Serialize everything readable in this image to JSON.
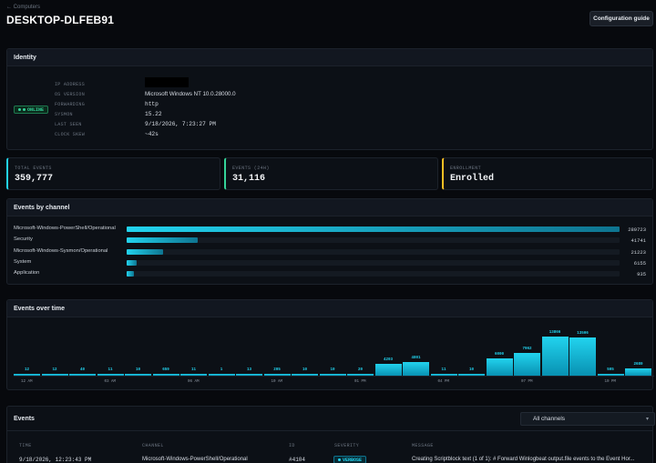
{
  "breadcrumb": "← Computers",
  "title": "DESKTOP-DLFEB91",
  "config_button": "Configuration guide",
  "identity": {
    "heading": "Identity",
    "status": "ONLINE",
    "rows": [
      {
        "label": "IP ADDRESS",
        "value": ""
      },
      {
        "label": "OS VERSION",
        "value": "Microsoft Windows NT 10.0.28000.0"
      },
      {
        "label": "FORWARDING",
        "value": "http"
      },
      {
        "label": "SYSMON",
        "value": "15.22"
      },
      {
        "label": "LAST SEEN",
        "value": "9/18/2026, 7:23:27 PM"
      },
      {
        "label": "CLOCK SKEW",
        "value": "~42s"
      }
    ]
  },
  "stats": [
    {
      "label": "TOTAL EVENTS",
      "value": "359,777",
      "accent": "#22d3ee"
    },
    {
      "label": "EVENTS (24H)",
      "value": "31,116",
      "accent": "#34d399"
    },
    {
      "label": "ENROLLMENT",
      "value": "Enrolled",
      "accent": "#fbbf24"
    }
  ],
  "channels": {
    "heading": "Events by channel",
    "max": 289723,
    "items": [
      {
        "name": "Microsoft-Windows-PowerShell/Operational",
        "count": 289723,
        "count_label": "289723"
      },
      {
        "name": "Security",
        "count": 41741,
        "count_label": "41741"
      },
      {
        "name": "Microsoft-Windows-Sysmon/Operational",
        "count": 21223,
        "count_label": "21223"
      },
      {
        "name": "System",
        "count": 6155,
        "count_label": "6155"
      },
      {
        "name": "Application",
        "count": 935,
        "count_label": "935"
      }
    ]
  },
  "timeline": {
    "heading": "Events over time",
    "max": 13506,
    "values": [
      12,
      12,
      40,
      11,
      10,
      659,
      11,
      1,
      13,
      205,
      10,
      10,
      20,
      4203,
      4801,
      11,
      10,
      6000,
      7962,
      13866,
      13506,
      505,
      2680
    ],
    "value_labels": [
      "12",
      "12",
      "40",
      "11",
      "10",
      "659",
      "11",
      "1",
      "13",
      "205",
      "10",
      "10",
      "20",
      "4203",
      "4801",
      "11",
      "10",
      "6000",
      "7962",
      "13866",
      "13506",
      "505",
      "2680"
    ],
    "ticks": [
      {
        "label": "12 AM",
        "index": 0
      },
      {
        "label": "03 AM",
        "index": 3
      },
      {
        "label": "06 AM",
        "index": 6
      },
      {
        "label": "10 AM",
        "index": 9
      },
      {
        "label": "01 PM",
        "index": 12
      },
      {
        "label": "04 PM",
        "index": 15
      },
      {
        "label": "07 PM",
        "index": 18
      },
      {
        "label": "10 PM",
        "index": 21
      }
    ]
  },
  "events": {
    "heading": "Events",
    "filter": "All channels",
    "columns": [
      "TIME",
      "CHANNEL",
      "ID",
      "SEVERITY",
      "MESSAGE"
    ],
    "rows": [
      {
        "time": "9/18/2026, 12:23:43 PM",
        "channel": "Microsoft-Windows-PowerShell/Operational",
        "id": "#4104",
        "severity": "VERBOSE",
        "message": "Creating Scriptblock text (1 of 1): # Forward Winlogbeat output.file events to the Event Hor..."
      }
    ]
  }
}
